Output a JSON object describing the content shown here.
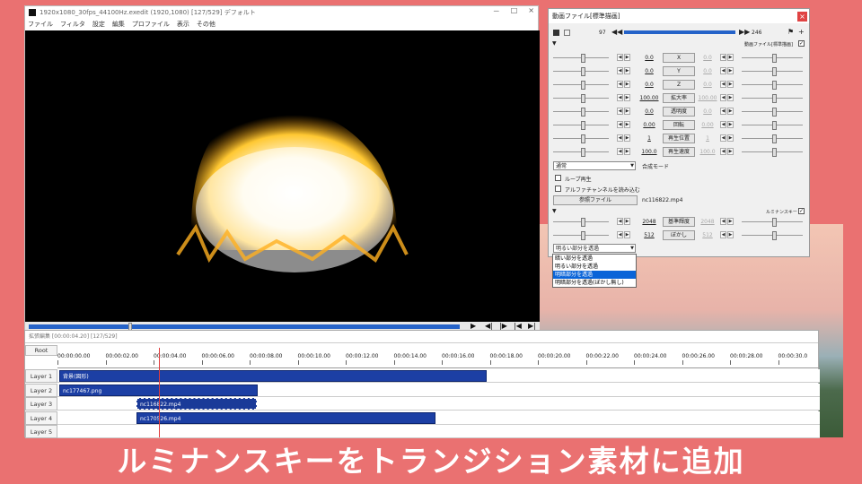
{
  "main_window": {
    "title": "1920x1080_30fps_44100Hz.exedit (1920,1080)  [127/529]  デフォルト",
    "controls": [
      "－",
      "□",
      "×"
    ],
    "menu": [
      "ファイル",
      "フィルタ",
      "設定",
      "編集",
      "プロファイル",
      "表示",
      "その他"
    ]
  },
  "properties": {
    "title": "動画ファイル[標準描画]",
    "close": "×",
    "frame_start": "97",
    "frame_end": "246",
    "section1_label": "動画ファイル[標準描画]",
    "rows": [
      {
        "label": "X",
        "left": "0.0",
        "right": "0.0"
      },
      {
        "label": "Y",
        "left": "0.0",
        "right": "0.0"
      },
      {
        "label": "Z",
        "left": "0.0",
        "right": "0.0"
      },
      {
        "label": "拡大率",
        "left": "100.00",
        "right": "100.00"
      },
      {
        "label": "透明度",
        "left": "0.0",
        "right": "0.0"
      },
      {
        "label": "回転",
        "left": "0.00",
        "right": "0.00"
      },
      {
        "label": "再生位置",
        "left": "1",
        "right": "1"
      },
      {
        "label": "再生速度",
        "left": "100.0",
        "right": "100.0"
      }
    ],
    "blend_value": "通常",
    "blend_label": "合成モード",
    "loop_label": "ループ再生",
    "alpha_label": "アルファチャンネルを読み込む",
    "ref_button": "参照ファイル",
    "filename": "nc116822.mp4",
    "section2_label": "ルミナンスキー",
    "luma_rows": [
      {
        "label": "基準輝度",
        "left": "2048",
        "right": "2048"
      },
      {
        "label": "ぼかし",
        "left": "512",
        "right": "512"
      }
    ],
    "mode_value": "明るい部分を透過",
    "dropdown_options": [
      "暗い部分を透過",
      "明るい部分を透過",
      "明暗部分を透過",
      "明暗部分を透過(ぼかし無し)"
    ],
    "dropdown_selected": "明暗部分を透過"
  },
  "timeline": {
    "title": "拡張編集 [00:00:04.20] [127/529]",
    "root": "Root",
    "ticks": [
      "00:00:00.00",
      "00:00:02.00",
      "00:00:04.00",
      "00:00:06.00",
      "00:00:08.00",
      "00:00:10.00",
      "00:00:12.00",
      "00:00:14.00",
      "00:00:16.00",
      "00:00:18.00",
      "00:00:20.00",
      "00:00:22.00",
      "00:00:24.00",
      "00:00:26.00",
      "00:00:28.00",
      "00:00:30.0"
    ],
    "layers": [
      "Layer 1",
      "Layer 2",
      "Layer 3",
      "Layer 4",
      "Layer 5"
    ],
    "clips": [
      {
        "name": "背景(図形)"
      },
      {
        "name": "nc177467.png"
      },
      {
        "name": "nc116822.mp4"
      },
      {
        "name": "nc170526.mp4"
      }
    ]
  },
  "caption": "ルミナンスキーをトランジション素材に追加",
  "colors": {
    "accent": "#2563c9",
    "background": "#ea7171",
    "clip": "#1c3fa4"
  }
}
